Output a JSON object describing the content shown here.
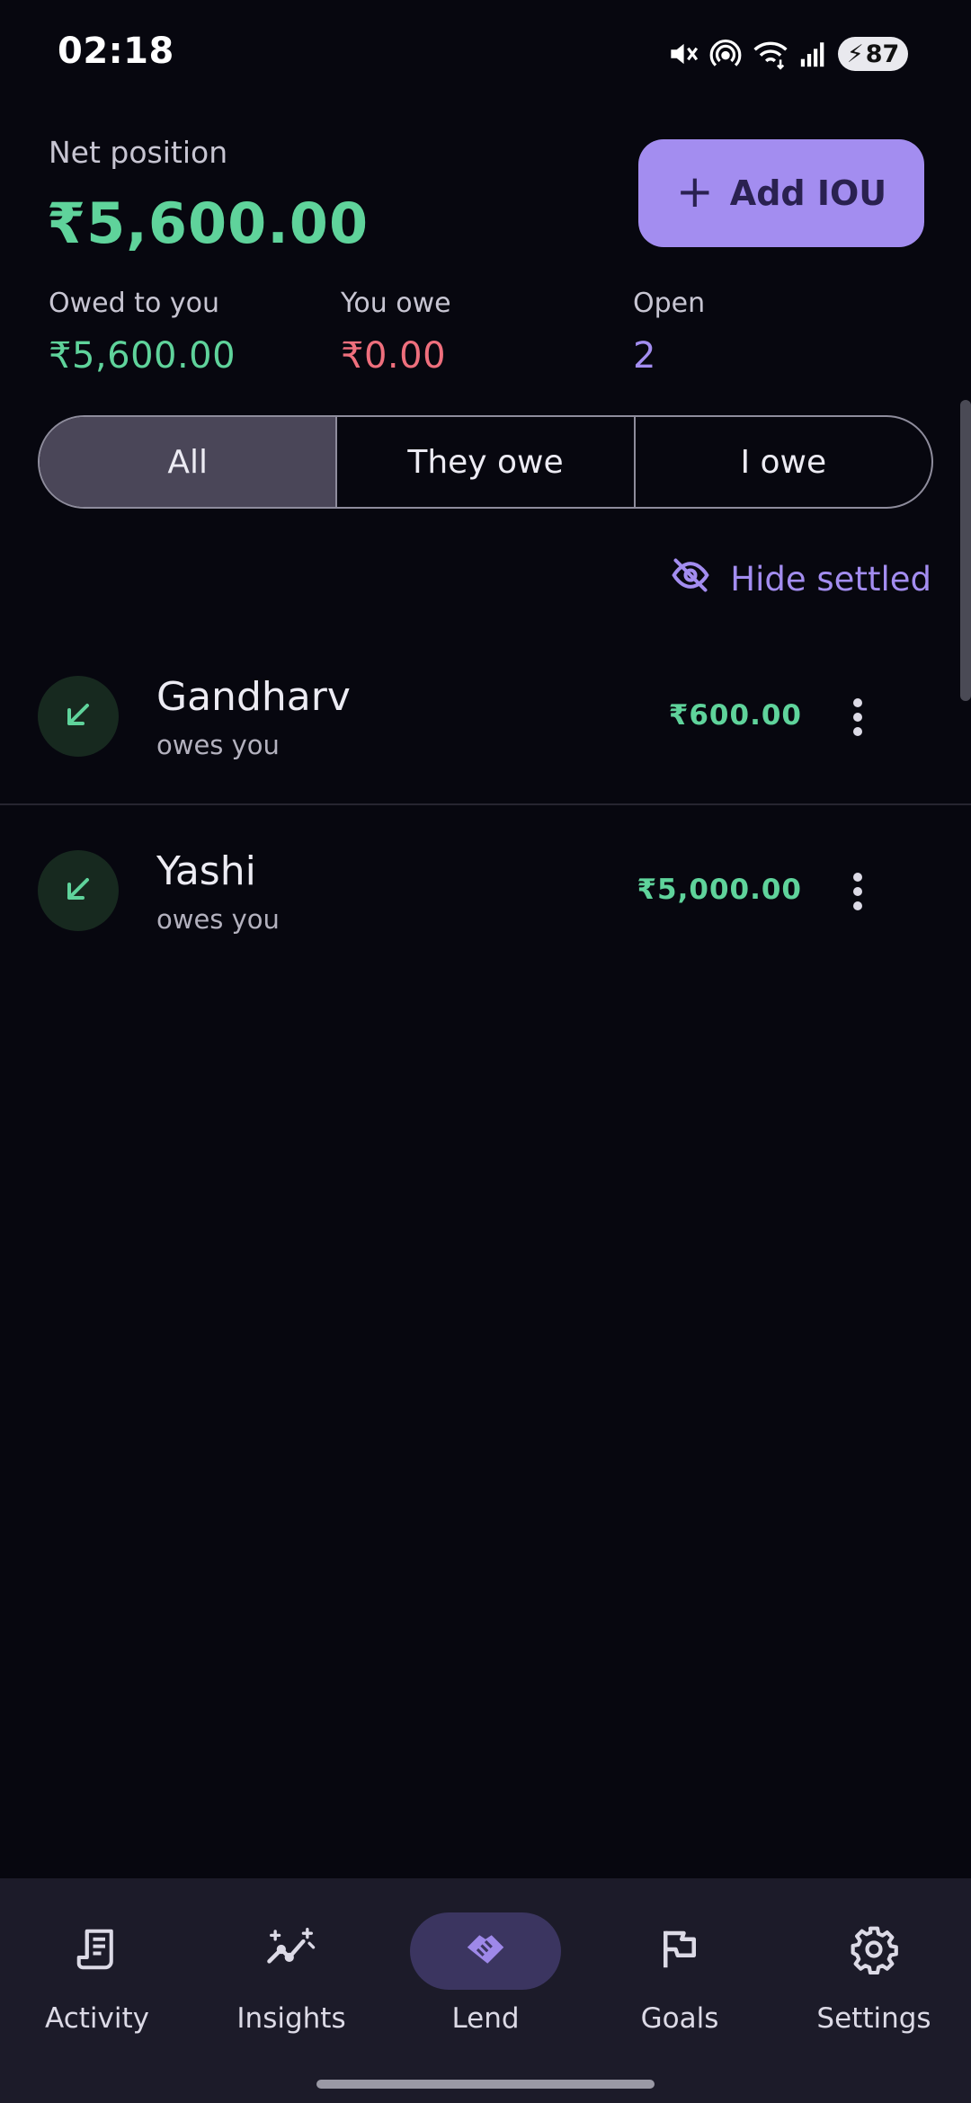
{
  "status_bar": {
    "time": "02:18",
    "battery": "87"
  },
  "header": {
    "net_label": "Net position",
    "net_amount": "₹5,600.00",
    "add_button": "Add IOU"
  },
  "stats": [
    {
      "label": "Owed to you",
      "value": "₹5,600.00",
      "color": "#5fd39b"
    },
    {
      "label": "You owe",
      "value": "₹0.00",
      "color": "#ef6f7d"
    },
    {
      "label": "Open",
      "value": "2",
      "color": "#a38df0"
    }
  ],
  "filters": {
    "options": [
      "All",
      "They owe",
      "I owe"
    ],
    "selected": "All"
  },
  "hide_settled": {
    "label": "Hide settled",
    "icon": "eye-off-icon"
  },
  "entries": [
    {
      "name": "Gandharv",
      "status": "owes you",
      "amount": "₹600.00",
      "icon": "arrow-down-left-icon"
    },
    {
      "name": "Yashi",
      "status": "owes you",
      "amount": "₹5,000.00",
      "icon": "arrow-down-left-icon"
    }
  ],
  "nav": {
    "items": [
      {
        "label": "Activity",
        "icon": "receipt-icon"
      },
      {
        "label": "Insights",
        "icon": "trend-sparkle-icon"
      },
      {
        "label": "Lend",
        "icon": "handshake-icon"
      },
      {
        "label": "Goals",
        "icon": "flag-icon"
      },
      {
        "label": "Settings",
        "icon": "gear-icon"
      }
    ],
    "active": "Lend"
  },
  "colors": {
    "background": "#07070f",
    "accent": "#a38df0",
    "positive": "#5fd39b",
    "negative": "#ef6f7d",
    "nav_background": "#1c1b29"
  }
}
